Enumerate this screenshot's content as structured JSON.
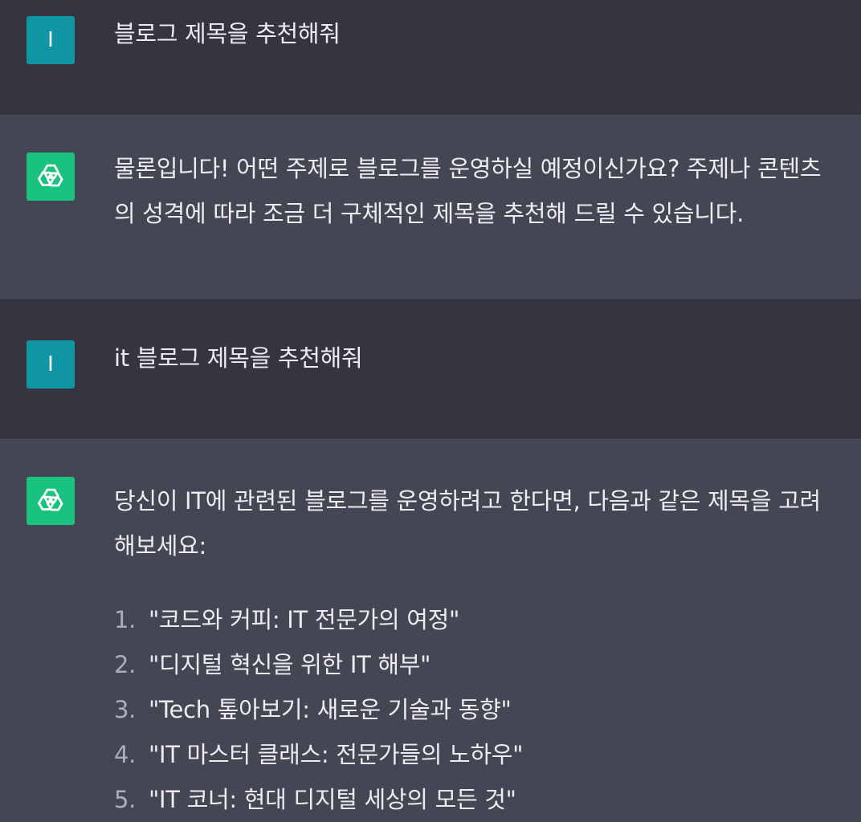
{
  "conversation": [
    {
      "role": "user",
      "avatar_letter": "I",
      "text": "블로그 제목을 추천해줘"
    },
    {
      "role": "assistant",
      "avatar_icon": "openai-logo-icon",
      "text": "물론입니다! 어떤 주제로 블로그를 운영하실 예정이신가요? 주제나 콘텐츠의 성격에 따라 조금 더 구체적인 제목을 추천해 드릴 수 있습니다."
    },
    {
      "role": "user",
      "avatar_letter": "I",
      "text": "it 블로그 제목을 추천해줘"
    },
    {
      "role": "assistant",
      "avatar_icon": "openai-logo-icon",
      "text": "당신이 IT에 관련된 블로그를 운영하려고 한다면, 다음과 같은 제목을 고려해보세요:",
      "list": [
        {
          "num": "1.",
          "text": "\"코드와 커피: IT 전문가의 여정\""
        },
        {
          "num": "2.",
          "text": "\"디지털 혁신을 위한 IT 해부\""
        },
        {
          "num": "3.",
          "text": "\"Tech 톺아보기: 새로운 기술과 동향\""
        },
        {
          "num": "4.",
          "text": "\"IT 마스터 클래스: 전문가들의 노하우\""
        },
        {
          "num": "5.",
          "text": "\"IT 코너: 현대 디지털 세상의 모든 것\""
        }
      ]
    }
  ],
  "colors": {
    "user_bg": "#343541",
    "assistant_bg": "#444654",
    "user_avatar": "#0f95a4",
    "assistant_avatar": "#19c37d",
    "text": "#ececf1",
    "list_number": "#acacbe"
  }
}
